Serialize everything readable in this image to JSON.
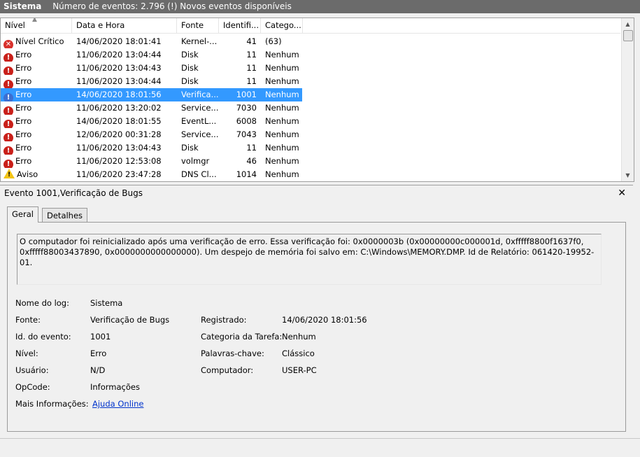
{
  "header": {
    "title": "Sistema",
    "count_text": "Número de eventos: 2.796 (!) Novos eventos disponíveis"
  },
  "columns": [
    "Nível",
    "Data e Hora",
    "Fonte",
    "Identifi...",
    "Catego..."
  ],
  "rows": [
    {
      "level": "Nível Crítico",
      "icon": "critical-icon",
      "date": "14/06/2020 18:01:41",
      "source": "Kernel-...",
      "id": "41",
      "category": "(63)"
    },
    {
      "level": "Erro",
      "icon": "error-icon",
      "date": "11/06/2020 13:04:44",
      "source": "Disk",
      "id": "11",
      "category": "Nenhum"
    },
    {
      "level": "Erro",
      "icon": "error-icon",
      "date": "11/06/2020 13:04:43",
      "source": "Disk",
      "id": "11",
      "category": "Nenhum"
    },
    {
      "level": "Erro",
      "icon": "error-icon",
      "date": "11/06/2020 13:04:44",
      "source": "Disk",
      "id": "11",
      "category": "Nenhum"
    },
    {
      "level": "Erro",
      "icon": "error-icon",
      "date": "14/06/2020 18:01:56",
      "source": "Verifica...",
      "id": "1001",
      "category": "Nenhum",
      "selected": true
    },
    {
      "level": "Erro",
      "icon": "error-icon",
      "date": "11/06/2020 13:20:02",
      "source": "Service...",
      "id": "7030",
      "category": "Nenhum"
    },
    {
      "level": "Erro",
      "icon": "error-icon",
      "date": "14/06/2020 18:01:55",
      "source": "EventL...",
      "id": "6008",
      "category": "Nenhum"
    },
    {
      "level": "Erro",
      "icon": "error-icon",
      "date": "12/06/2020 00:31:28",
      "source": "Service...",
      "id": "7043",
      "category": "Nenhum"
    },
    {
      "level": "Erro",
      "icon": "error-icon",
      "date": "11/06/2020 13:04:43",
      "source": "Disk",
      "id": "11",
      "category": "Nenhum"
    },
    {
      "level": "Erro",
      "icon": "error-icon",
      "date": "11/06/2020 12:53:08",
      "source": "volmgr",
      "id": "46",
      "category": "Nenhum"
    },
    {
      "level": "Aviso",
      "icon": "warning-icon",
      "date": "11/06/2020 23:47:28",
      "source": "DNS Cl...",
      "id": "1014",
      "category": "Nenhum"
    }
  ],
  "detail": {
    "title": "Evento 1001,Verificação de Bugs",
    "tabs": [
      "Geral",
      "Detalhes"
    ],
    "message": "O computador foi reinicializado após uma verificação de erro. Essa verificação foi: 0x0000003b (0x00000000c000001d, 0xfffff8800f1637f0, 0xfffff88003437890, 0x0000000000000000). Um despejo de memória foi salvo em: C:\\Windows\\MEMORY.DMP. Id de Relatório: 061420-19952-01.",
    "fields": {
      "log_name_label": "Nome do log:",
      "log_name": "Sistema",
      "source_label": "Fonte:",
      "source": "Verificação de Bugs",
      "event_id_label": "Id. do evento:",
      "event_id": "1001",
      "level_label": "Nível:",
      "level": "Erro",
      "user_label": "Usuário:",
      "user": "N/D",
      "opcode_label": "OpCode:",
      "opcode": "Informações",
      "more_info_label": "Mais Informações:",
      "more_info_link": "Ajuda Online",
      "logged_label": "Registrado:",
      "logged": "14/06/2020 18:01:56",
      "task_label": "Categoria da Tarefa:",
      "task": "Nenhum",
      "keywords_label": "Palavras-chave:",
      "keywords": "Clássico",
      "computer_label": "Computador:",
      "computer": "USER-PC"
    }
  }
}
